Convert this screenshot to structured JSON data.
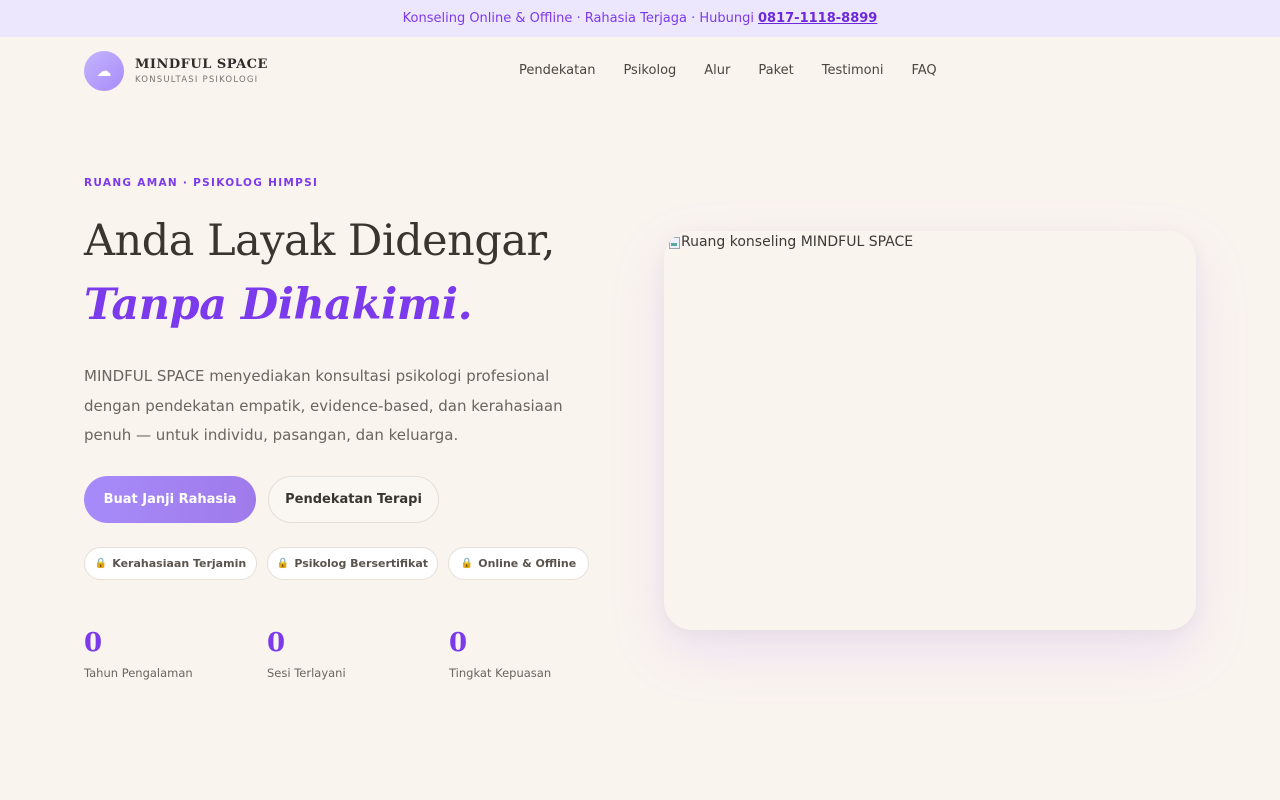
{
  "topbar": {
    "text": "Konseling Online & Offline · Rahasia Terjaga · Hubungi",
    "phone": "0817-1118-8899"
  },
  "brand": {
    "name": "MINDFUL SPACE",
    "tagline": "KONSULTASI PSIKOLOGI",
    "icon": "cloud-icon"
  },
  "nav": [
    "Pendekatan",
    "Psikolog",
    "Alur",
    "Paket",
    "Testimoni",
    "FAQ"
  ],
  "hero": {
    "eyebrow": "RUANG AMAN · PSIKOLOG HIMPSI",
    "title_line1": "Anda Layak Didengar,",
    "title_line2": "Tanpa Dihakimi.",
    "lede": "MINDFUL SPACE menyediakan konsultasi psikologi profesional dengan pendekatan empatik, evidence-based, dan kerahasiaan penuh — untuk individu, pasangan, dan keluarga.",
    "primary_cta": "Buat Janji Rahasia",
    "secondary_cta": "Pendekatan Terapi",
    "badges": [
      "Kerahasiaan Terjamin",
      "Psikolog Bersertifikat",
      "Online & Offline"
    ],
    "stats": [
      {
        "value": "0",
        "label": "Tahun Pengalaman"
      },
      {
        "value": "0",
        "label": "Sesi Terlayani"
      },
      {
        "value": "0",
        "label": "Tingkat Kepuasan"
      }
    ],
    "image_alt": "Ruang konseling MINDFUL SPACE"
  },
  "colors": {
    "accent": "#7c3aed",
    "button": "#a78bfa",
    "background": "#faf4ef",
    "topbar": "#ede7fd"
  }
}
